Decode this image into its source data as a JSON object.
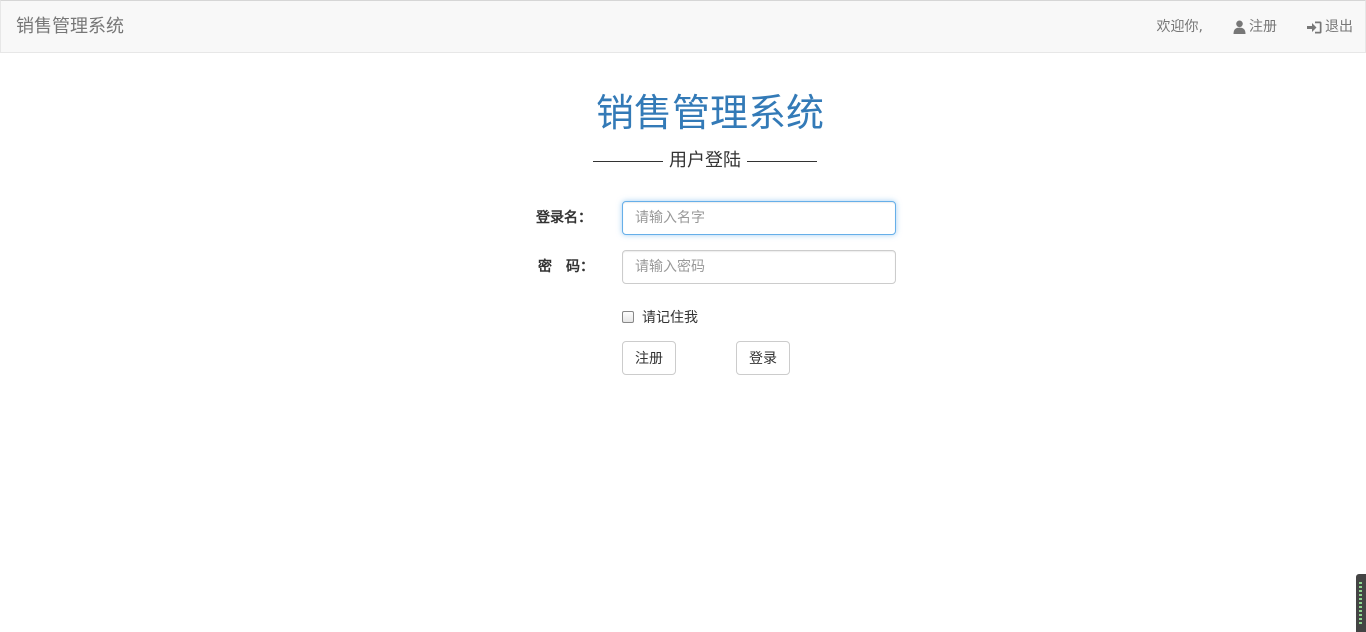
{
  "navbar": {
    "brand": "销售管理系统",
    "welcome": "欢迎你,",
    "register_label": "注册",
    "logout_label": "退出"
  },
  "login": {
    "title": "销售管理系统",
    "subtitle": "用户登陆",
    "username_label": "登录名：",
    "username_placeholder": "请输入名字",
    "password_label": "密　码：",
    "password_placeholder": "请输入密码",
    "remember_label": "请记住我",
    "register_button": "注册",
    "login_button": "登录"
  },
  "colors": {
    "title": "#337ab7",
    "navbar_bg": "#f8f8f8",
    "focus_border": "#66afe9"
  },
  "icons": {
    "register": "user-icon",
    "logout": "sign-in-icon"
  }
}
